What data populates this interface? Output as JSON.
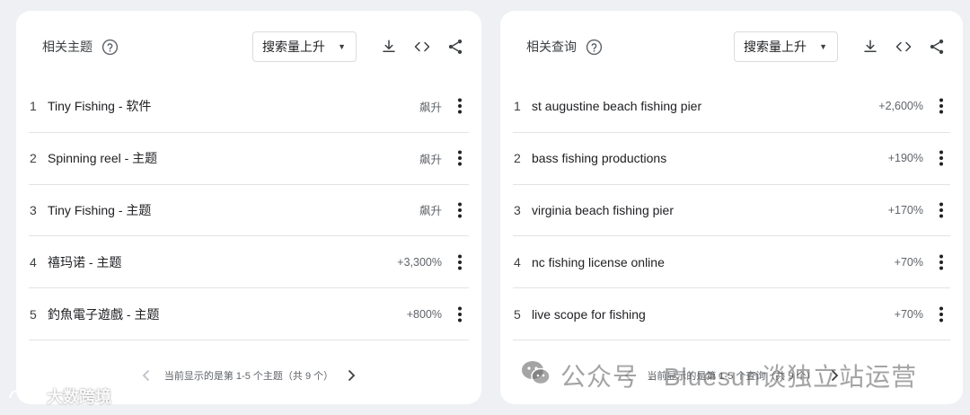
{
  "left_card": {
    "title": "相关主题",
    "sort_label": "搜索量上升",
    "rows": [
      {
        "index": "1",
        "label": "Tiny Fishing - 软件",
        "value": "飙升"
      },
      {
        "index": "2",
        "label": "Spinning reel - 主题",
        "value": "飙升"
      },
      {
        "index": "3",
        "label": "Tiny Fishing - 主题",
        "value": "飙升"
      },
      {
        "index": "4",
        "label": "禧玛诺 - 主题",
        "value": "+3,300%"
      },
      {
        "index": "5",
        "label": "釣魚電子遊戲 - 主题",
        "value": "+800%"
      }
    ],
    "pager_text": "当前显示的是第 1-5 个主题（共 9 个）"
  },
  "right_card": {
    "title": "相关查询",
    "sort_label": "搜索量上升",
    "rows": [
      {
        "index": "1",
        "label": "st augustine beach fishing pier",
        "value": "+2,600%"
      },
      {
        "index": "2",
        "label": "bass fishing productions",
        "value": "+190%"
      },
      {
        "index": "3",
        "label": "virginia beach fishing pier",
        "value": "+170%"
      },
      {
        "index": "4",
        "label": "nc fishing license online",
        "value": "+70%"
      },
      {
        "index": "5",
        "label": "live scope for fishing",
        "value": "+70%"
      }
    ],
    "pager_text": "当前显示的是第 1-5 个查询（共 9 个）"
  },
  "watermark": {
    "text": "公众号 · Bluesun谈独立站运营",
    "corner_text": "大数跨境"
  },
  "icons": {
    "help": "help-circle-icon",
    "download": "download-icon",
    "embed": "code-icon",
    "share": "share-icon",
    "more": "more-vert-icon",
    "prev": "chevron-left-icon",
    "next": "chevron-right-icon"
  },
  "colors": {
    "background": "#eef0f3",
    "card": "#ffffff",
    "text": "#202124",
    "muted": "#5f6368",
    "divider": "#e3e3e3"
  }
}
